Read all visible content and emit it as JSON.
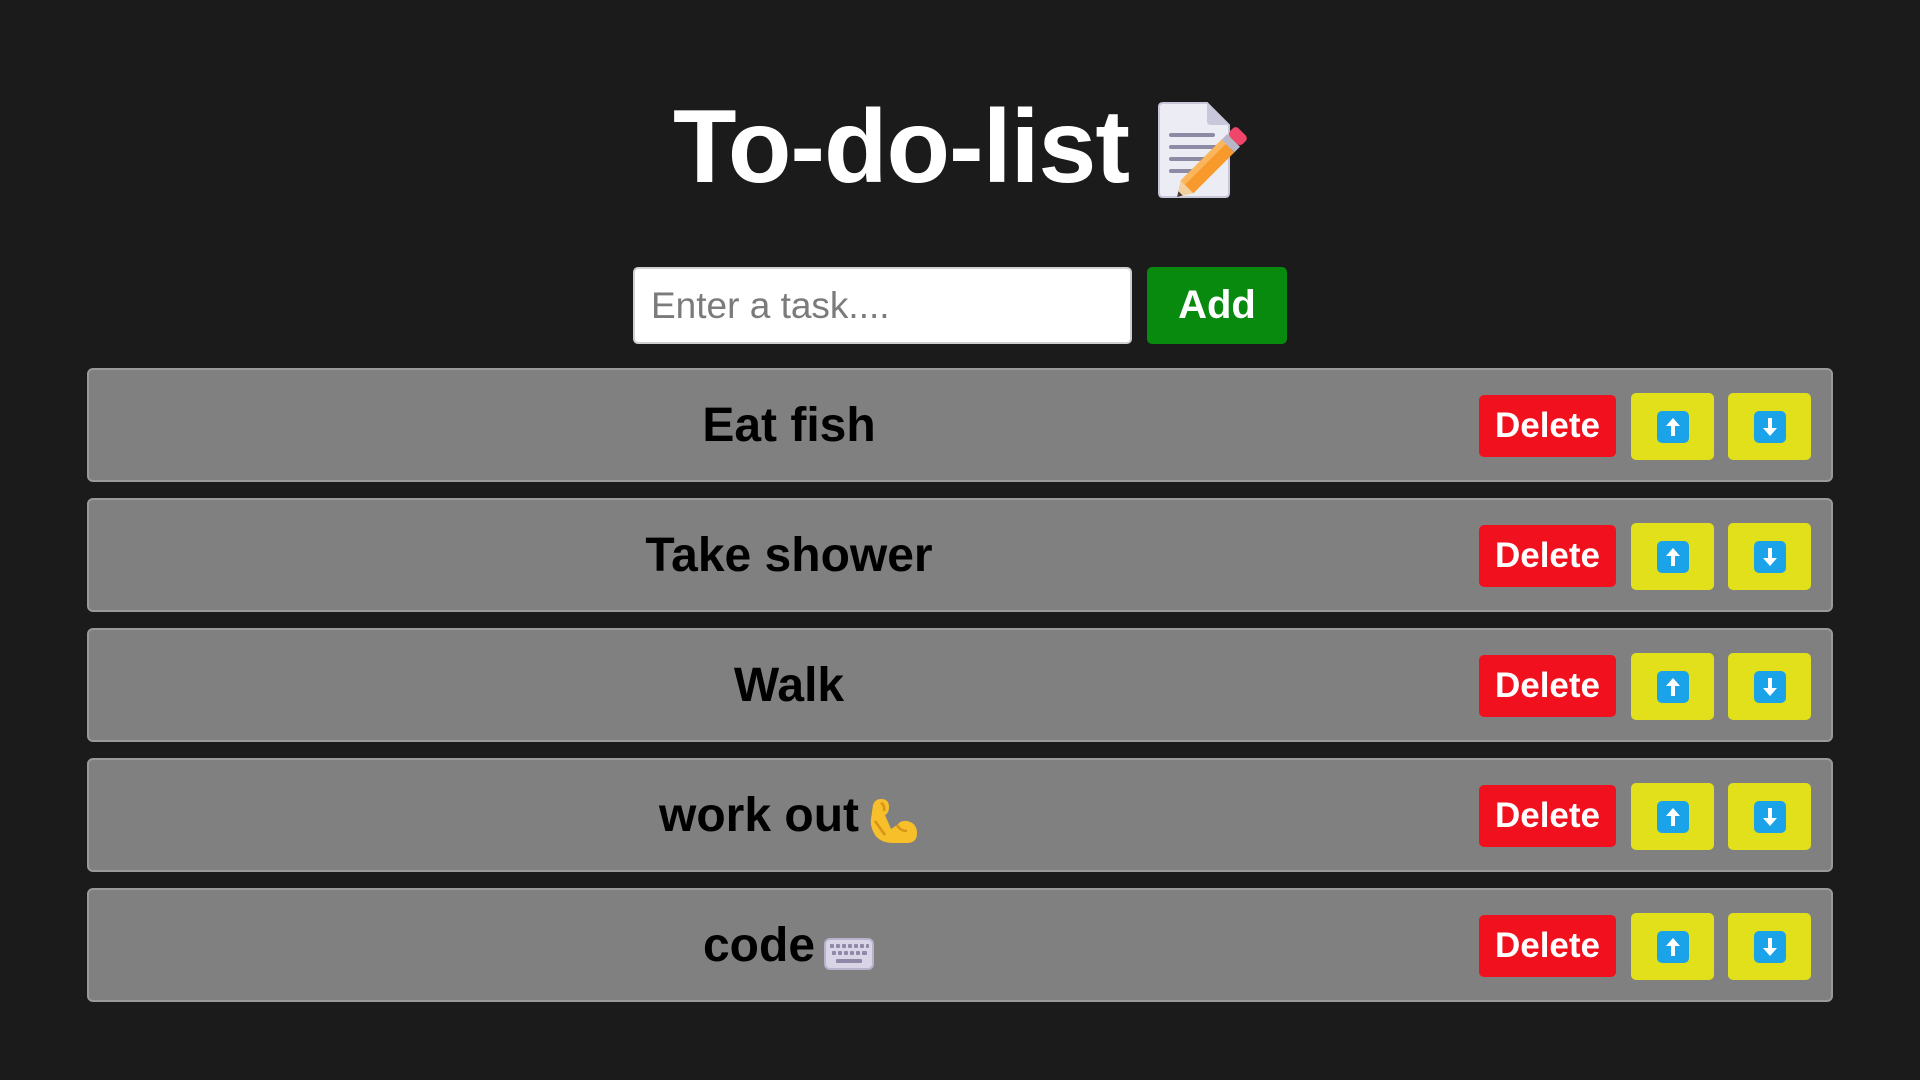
{
  "header": {
    "title": "To-do-list",
    "title_icon": "memo-pencil-icon"
  },
  "input": {
    "placeholder": "Enter a task....",
    "value": ""
  },
  "add_button": {
    "label": "Add",
    "color": "#078a0d"
  },
  "tasks": [
    {
      "text": "Eat fish",
      "emoji": ""
    },
    {
      "text": "Take shower",
      "emoji": ""
    },
    {
      "text": "Walk",
      "emoji": ""
    },
    {
      "text": "work out",
      "emoji": "flexed-biceps-icon"
    },
    {
      "text": "code",
      "emoji": "keyboard-icon"
    }
  ],
  "task_buttons": {
    "delete_label": "Delete",
    "move_up_icon": "up-arrow-icon",
    "move_down_icon": "down-arrow-icon"
  },
  "colors": {
    "background": "#1b1b1b",
    "task_bg": "#808080",
    "delete": "#f0101e",
    "move": "#e1e01a",
    "arrow": "#1aa3e8"
  }
}
